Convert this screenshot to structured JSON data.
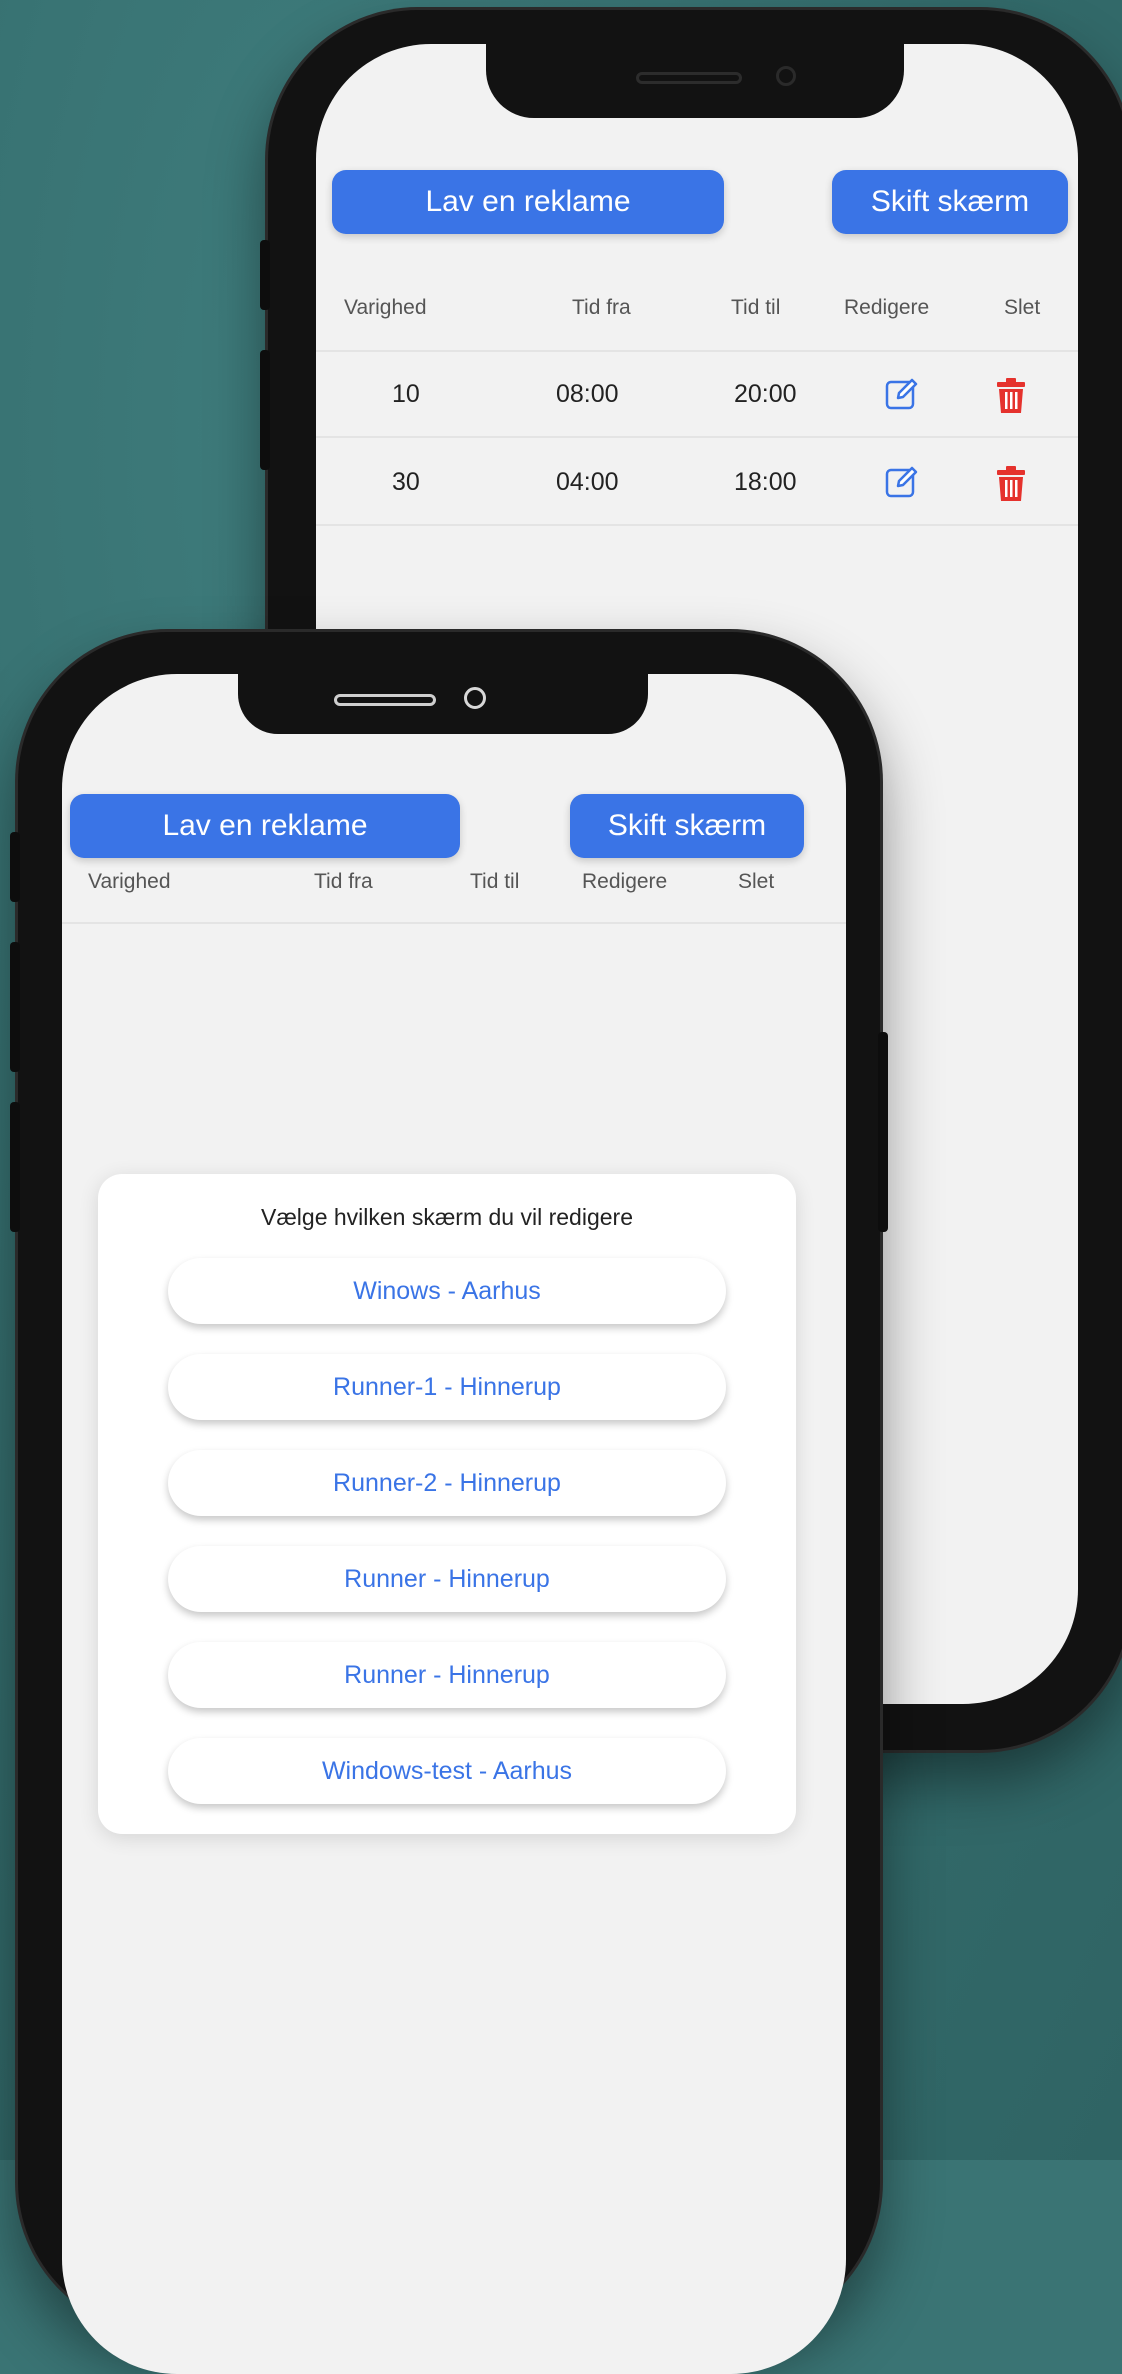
{
  "back_phone": {
    "buttons": {
      "create_ad": "Lav en reklame",
      "switch_screen": "Skift skærm"
    },
    "columns": [
      "Varighed",
      "Tid fra",
      "Tid til",
      "Redigere",
      "Slet"
    ],
    "rows": [
      {
        "duration": "10",
        "from": "08:00",
        "to": "20:00"
      },
      {
        "duration": "30",
        "from": "04:00",
        "to": "18:00"
      }
    ]
  },
  "front_phone": {
    "buttons": {
      "create_ad": "Lav en reklame",
      "switch_screen": "Skift skærm"
    },
    "columns": [
      "Varighed",
      "Tid fra",
      "Tid til",
      "Redigere",
      "Slet"
    ],
    "modal": {
      "title": "Vælge hvilken skærm du vil redigere",
      "options": [
        "Winows - Aarhus",
        "Runner-1 - Hinnerup",
        "Runner-2 - Hinnerup",
        "Runner - Hinnerup",
        "Runner - Hinnerup",
        "Windows-test - Aarhus"
      ]
    }
  },
  "colors": {
    "accent": "#3a74e6",
    "delete": "#e5322d",
    "background": "#3a7474"
  },
  "icons": {
    "edit": "edit-square-pencil-icon",
    "delete": "trash-icon"
  }
}
